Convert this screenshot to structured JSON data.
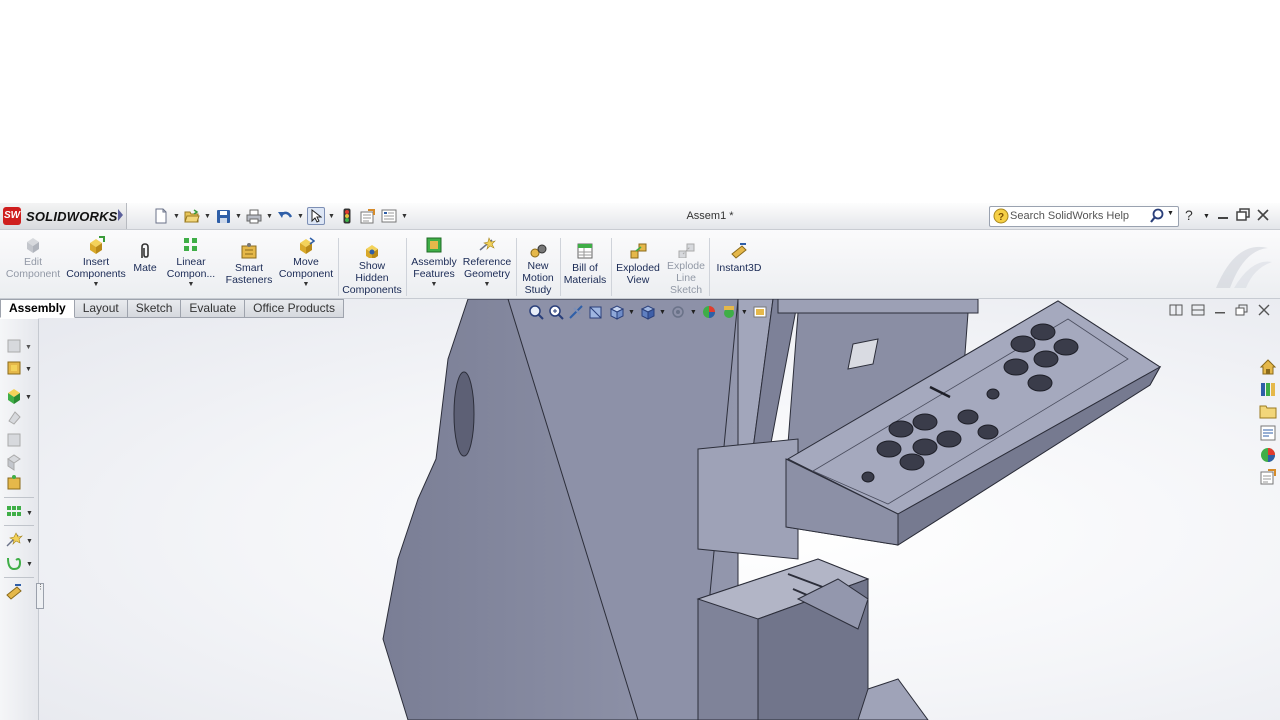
{
  "app": {
    "brand": "SOLIDWORKS",
    "logo_mark": "SW",
    "document_title": "Assem1 *",
    "search_placeholder": "Search SolidWorks Help"
  },
  "quick_access": [
    {
      "name": "new-document",
      "icon": "new-file-icon"
    },
    {
      "name": "open-document",
      "icon": "folder-open-icon"
    },
    {
      "name": "save",
      "icon": "save-icon"
    },
    {
      "name": "print",
      "icon": "printer-icon"
    },
    {
      "name": "undo",
      "icon": "undo-icon"
    },
    {
      "name": "select",
      "icon": "pointer-icon"
    },
    {
      "name": "rebuild",
      "icon": "traffic-light-icon"
    },
    {
      "name": "file-properties",
      "icon": "properties-icon"
    },
    {
      "name": "options",
      "icon": "options-list-icon"
    }
  ],
  "ribbon": {
    "edit_component": [
      "Edit",
      "Component"
    ],
    "insert_components": [
      "Insert",
      "Components"
    ],
    "mate": [
      "Mate"
    ],
    "linear_component": [
      "Linear",
      "Compon..."
    ],
    "smart_fasteners": [
      "Smart",
      "Fasteners"
    ],
    "move_component": [
      "Move",
      "Component"
    ],
    "show_hidden": [
      "Show",
      "Hidden",
      "Components"
    ],
    "assembly_features": [
      "Assembly",
      "Features"
    ],
    "reference_geometry": [
      "Reference",
      "Geometry"
    ],
    "motion_study": [
      "New",
      "Motion",
      "Study"
    ],
    "bill_of_materials": [
      "Bill of",
      "Materials"
    ],
    "exploded_view": [
      "Exploded",
      "View"
    ],
    "explode_line": [
      "Explode",
      "Line",
      "Sketch"
    ],
    "instant3d": [
      "Instant3D"
    ]
  },
  "tabs": [
    "Assembly",
    "Layout",
    "Sketch",
    "Evaluate",
    "Office Products"
  ],
  "active_tab": "Assembly",
  "colors": {
    "brand_red": "#cf1e1e",
    "model_face": "#8b8fa6",
    "model_edge": "#2c2e3a",
    "ribbon_text": "#1a2a55"
  }
}
